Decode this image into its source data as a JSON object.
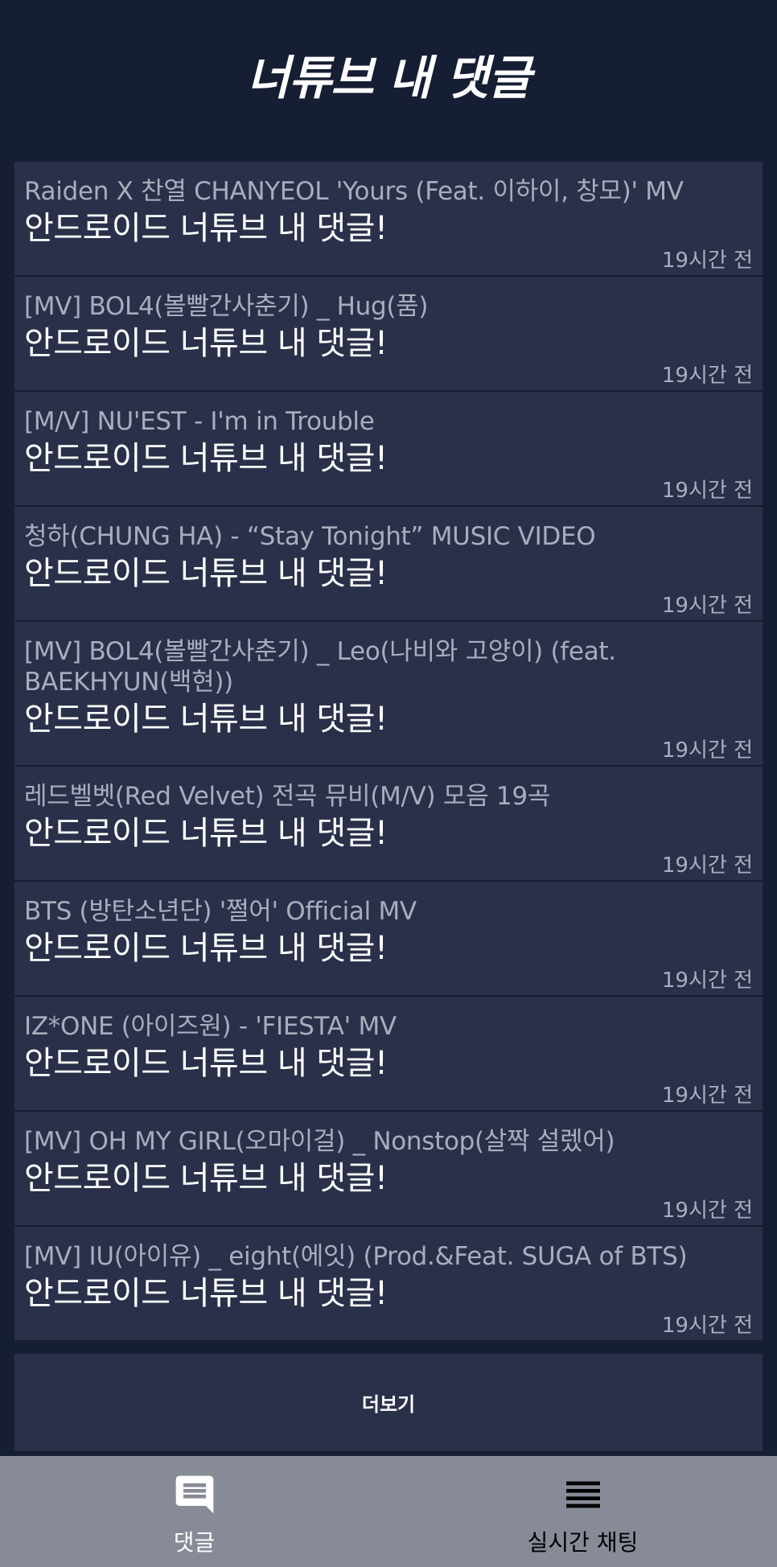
{
  "header": {
    "title": "너튜브 내 댓글"
  },
  "comments": [
    {
      "video_title": "Raiden X 찬열 CHANYEOL 'Yours (Feat. 이하이, 창모)' MV",
      "comment": "안드로이드 너튜브 내 댓글!",
      "time": "19시간 전"
    },
    {
      "video_title": "[MV] BOL4(볼빨간사춘기) _ Hug(품)",
      "comment": "안드로이드 너튜브 내 댓글!",
      "time": "19시간 전"
    },
    {
      "video_title": "[M/V] NU'EST - I'm in Trouble",
      "comment": "안드로이드 너튜브 내 댓글!",
      "time": "19시간 전"
    },
    {
      "video_title": "청하(CHUNG HA) - “Stay Tonight” MUSIC VIDEO",
      "comment": "안드로이드 너튜브 내 댓글!",
      "time": "19시간 전"
    },
    {
      "video_title": "[MV] BOL4(볼빨간사춘기) _ Leo(나비와 고양이) (feat. BAEKHYUN(백현))",
      "comment": "안드로이드 너튜브 내 댓글!",
      "time": "19시간 전"
    },
    {
      "video_title": "레드벨벳(Red Velvet) 전곡 뮤비(M/V) 모음 19곡",
      "comment": "안드로이드 너튜브 내 댓글!",
      "time": "19시간 전"
    },
    {
      "video_title": "BTS (방탄소년단) '쩔어' Official MV",
      "comment": "안드로이드 너튜브 내 댓글!",
      "time": "19시간 전"
    },
    {
      "video_title": "IZ*ONE (아이즈원) - 'FIESTA' MV",
      "comment": "안드로이드 너튜브 내 댓글!",
      "time": "19시간 전"
    },
    {
      "video_title": "[MV] OH MY GIRL(오마이걸) _ Nonstop(살짝 설렜어)",
      "comment": "안드로이드 너튜브 내 댓글!",
      "time": "19시간 전"
    },
    {
      "video_title": "[MV] IU(아이유) _ eight(에잇) (Prod.&Feat. SUGA of BTS)",
      "comment": "안드로이드 너튜브 내 댓글!",
      "time": "19시간 전"
    }
  ],
  "more_button": {
    "label": "더보기"
  },
  "bottom_nav": {
    "items": [
      {
        "label": "댓글",
        "icon": "comment-icon"
      },
      {
        "label": "실시간 채팅",
        "icon": "list-icon"
      }
    ]
  },
  "colors": {
    "background": "#161e33",
    "card": "#2a304a",
    "title_text": "#a9adbd",
    "comment_text": "#ffffff",
    "nav_background": "#868b97"
  }
}
